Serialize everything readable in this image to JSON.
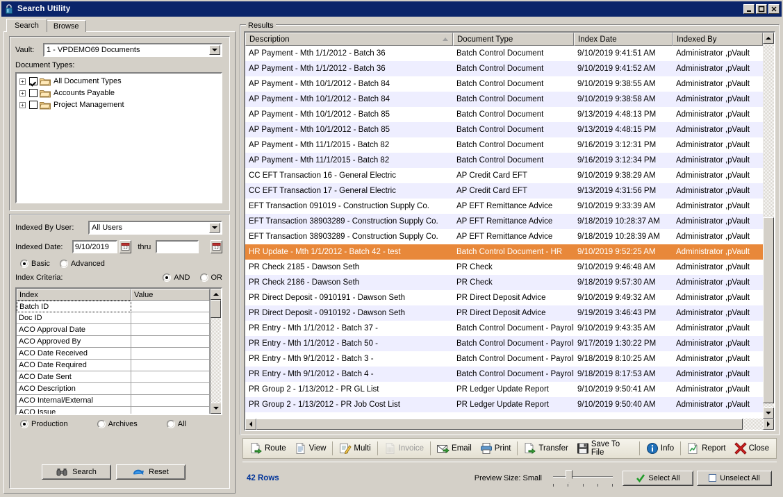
{
  "window": {
    "title": "Search Utility",
    "icon": "lock-icon",
    "minimize": "_",
    "maximize": "□",
    "close": "×"
  },
  "tabs": [
    {
      "label": "Search",
      "active": true
    },
    {
      "label": "Browse",
      "active": false
    }
  ],
  "search_panel": {
    "vault_label": "Vault:",
    "vault_value": "1 - VPDEMO69 Documents",
    "doc_types_label": "Document Types:",
    "doc_types": [
      {
        "label": "All Document Types",
        "checked": true
      },
      {
        "label": "Accounts Payable",
        "checked": false
      },
      {
        "label": "Project Management",
        "checked": false
      }
    ],
    "indexed_by_user_label": "Indexed By User:",
    "indexed_by_user_value": "All Users",
    "indexed_date_label": "Indexed Date:",
    "indexed_date_from": "9/10/2019",
    "thru_label": "thru",
    "indexed_date_to": "",
    "mode_basic": "Basic",
    "mode_advanced": "Advanced",
    "mode_selected": "Basic",
    "index_criteria_label": "Index Criteria:",
    "operator_and": "AND",
    "operator_or": "OR",
    "operator_selected": "AND",
    "criteria_headers": [
      "Index",
      "Value"
    ],
    "criteria_rows": [
      {
        "index": "Batch ID",
        "value": "",
        "selected": true
      },
      {
        "index": "Doc ID",
        "value": ""
      },
      {
        "index": "ACO Approval Date",
        "value": ""
      },
      {
        "index": "ACO Approved By",
        "value": ""
      },
      {
        "index": "ACO Date Received",
        "value": ""
      },
      {
        "index": "ACO Date Required",
        "value": ""
      },
      {
        "index": "ACO Date Sent",
        "value": ""
      },
      {
        "index": "ACO Description",
        "value": ""
      },
      {
        "index": "ACO Internal/External",
        "value": ""
      },
      {
        "index": "ACO Issue",
        "value": ""
      }
    ],
    "scope_options": [
      "Production",
      "Archives",
      "All"
    ],
    "scope_selected": "Production",
    "search_button": "Search",
    "reset_button": "Reset"
  },
  "results": {
    "legend": "Results",
    "columns": [
      {
        "label": "Description",
        "sorted": true
      },
      {
        "label": "Document Type"
      },
      {
        "label": "Index Date"
      },
      {
        "label": "Indexed By"
      }
    ],
    "rows": [
      {
        "description": "AP Payment - Mth 1/1/2012 - Batch 36",
        "doc_type": "Batch Control Document",
        "index_date": "9/10/2019 9:41:51 AM",
        "indexed_by": "Administrator ,pVault"
      },
      {
        "description": "AP Payment - Mth 1/1/2012 - Batch 36",
        "doc_type": "Batch Control Document",
        "index_date": "9/10/2019 9:41:52 AM",
        "indexed_by": "Administrator ,pVault"
      },
      {
        "description": "AP Payment - Mth 10/1/2012 - Batch 84",
        "doc_type": "Batch Control Document",
        "index_date": "9/10/2019 9:38:55 AM",
        "indexed_by": "Administrator ,pVault"
      },
      {
        "description": "AP Payment - Mth 10/1/2012 - Batch 84",
        "doc_type": "Batch Control Document",
        "index_date": "9/10/2019 9:38:58 AM",
        "indexed_by": "Administrator ,pVault"
      },
      {
        "description": "AP Payment - Mth 10/1/2012 - Batch 85",
        "doc_type": "Batch Control Document",
        "index_date": "9/13/2019 4:48:13 PM",
        "indexed_by": "Administrator ,pVault"
      },
      {
        "description": "AP Payment - Mth 10/1/2012 - Batch 85",
        "doc_type": "Batch Control Document",
        "index_date": "9/13/2019 4:48:15 PM",
        "indexed_by": "Administrator ,pVault"
      },
      {
        "description": "AP Payment - Mth 11/1/2015 - Batch 82",
        "doc_type": "Batch Control Document",
        "index_date": "9/16/2019 3:12:31 PM",
        "indexed_by": "Administrator ,pVault"
      },
      {
        "description": "AP Payment - Mth 11/1/2015 - Batch 82",
        "doc_type": "Batch Control Document",
        "index_date": "9/16/2019 3:12:34 PM",
        "indexed_by": "Administrator ,pVault"
      },
      {
        "description": "CC EFT Transaction      16 - General Electric",
        "doc_type": "AP Credit Card EFT",
        "index_date": "9/10/2019 9:38:29 AM",
        "indexed_by": "Administrator ,pVault"
      },
      {
        "description": "CC EFT Transaction      17 - General Electric",
        "doc_type": "AP Credit Card EFT",
        "index_date": "9/13/2019 4:31:56 PM",
        "indexed_by": "Administrator ,pVault"
      },
      {
        "description": "EFT Transaction    091019 - Construction Supply Co.",
        "doc_type": "AP EFT Remittance Advice",
        "index_date": "9/10/2019 9:33:39 AM",
        "indexed_by": "Administrator ,pVault"
      },
      {
        "description": "EFT Transaction   38903289 - Construction Supply Co.",
        "doc_type": "AP EFT Remittance Advice",
        "index_date": "9/18/2019 10:28:37 AM",
        "indexed_by": "Administrator ,pVault"
      },
      {
        "description": "EFT Transaction   38903289 - Construction Supply Co.",
        "doc_type": "AP EFT Remittance Advice",
        "index_date": "9/18/2019 10:28:39 AM",
        "indexed_by": "Administrator ,pVault"
      },
      {
        "description": "HR Update - Mth 1/1/2012 - Batch 42 - test",
        "doc_type": "Batch Control Document - HR",
        "index_date": "9/10/2019 9:52:25 AM",
        "indexed_by": "Administrator ,pVault",
        "selected": true
      },
      {
        "description": "PR Check      2185 - Dawson Seth",
        "doc_type": "PR Check",
        "index_date": "9/10/2019 9:46:48 AM",
        "indexed_by": "Administrator ,pVault"
      },
      {
        "description": "PR Check      2186 - Dawson Seth",
        "doc_type": "PR Check",
        "index_date": "9/18/2019 9:57:30 AM",
        "indexed_by": "Administrator ,pVault"
      },
      {
        "description": "PR Direct Deposit -    0910191 - Dawson Seth",
        "doc_type": "PR Direct Deposit Advice",
        "index_date": "9/10/2019 9:49:32 AM",
        "indexed_by": "Administrator ,pVault"
      },
      {
        "description": "PR Direct Deposit -    0910192 - Dawson Seth",
        "doc_type": "PR Direct Deposit Advice",
        "index_date": "9/19/2019 3:46:43 PM",
        "indexed_by": "Administrator ,pVault"
      },
      {
        "description": "PR Entry - Mth 1/1/2012 - Batch 37 -",
        "doc_type": "Batch Control Document - Payroll",
        "index_date": "9/10/2019 9:43:35 AM",
        "indexed_by": "Administrator ,pVault"
      },
      {
        "description": "PR Entry - Mth 1/1/2012 - Batch 50 -",
        "doc_type": "Batch Control Document - Payroll",
        "index_date": "9/17/2019 1:30:22 PM",
        "indexed_by": "Administrator ,pVault"
      },
      {
        "description": "PR Entry - Mth 9/1/2012 - Batch 3 -",
        "doc_type": "Batch Control Document - Payroll",
        "index_date": "9/18/2019 8:10:25 AM",
        "indexed_by": "Administrator ,pVault"
      },
      {
        "description": "PR Entry - Mth 9/1/2012 - Batch 4 -",
        "doc_type": "Batch Control Document - Payroll",
        "index_date": "9/18/2019 8:17:53 AM",
        "indexed_by": "Administrator ,pVault"
      },
      {
        "description": "PR Group 2 - 1/13/2012 - PR GL List",
        "doc_type": "PR Ledger Update Report",
        "index_date": "9/10/2019 9:50:41 AM",
        "indexed_by": "Administrator ,pVault"
      },
      {
        "description": "PR Group 2 - 1/13/2012 - PR Job Cost List",
        "doc_type": "PR Ledger Update Report",
        "index_date": "9/10/2019 9:50:40 AM",
        "indexed_by": "Administrator ,pVault"
      }
    ]
  },
  "toolbar": [
    {
      "label": "Route",
      "icon": "route-icon",
      "disabled": false
    },
    {
      "label": "View",
      "icon": "view-icon",
      "disabled": false
    },
    {
      "label": "Multi",
      "icon": "multi-icon",
      "disabled": false,
      "sep_before": true
    },
    {
      "label": "Invoice",
      "icon": "invoice-icon",
      "disabled": true,
      "sep_before": true
    },
    {
      "label": "Email",
      "icon": "email-icon",
      "disabled": false,
      "sep_before": true
    },
    {
      "label": "Print",
      "icon": "print-icon",
      "disabled": false
    },
    {
      "label": "Transfer",
      "icon": "transfer-icon",
      "disabled": false,
      "sep_before": true
    },
    {
      "label": "Save To File",
      "icon": "save-icon",
      "disabled": false
    },
    {
      "label": "Info",
      "icon": "info-icon",
      "disabled": false,
      "sep_before": true
    },
    {
      "label": "Report",
      "icon": "report-icon",
      "disabled": false,
      "sep_before": true
    },
    {
      "label": "Close",
      "icon": "close-icon",
      "disabled": false
    }
  ],
  "status": {
    "rows_count": "42 Rows",
    "preview_size_label": "Preview Size: Small",
    "select_all": "Select All",
    "unselect_all": "Unselect All"
  },
  "colors": {
    "titlebar": "#0a246a",
    "face": "#d4d0c8",
    "alt_row": "#eeeeff",
    "selection": "#e8883a",
    "status_link": "#003399"
  }
}
